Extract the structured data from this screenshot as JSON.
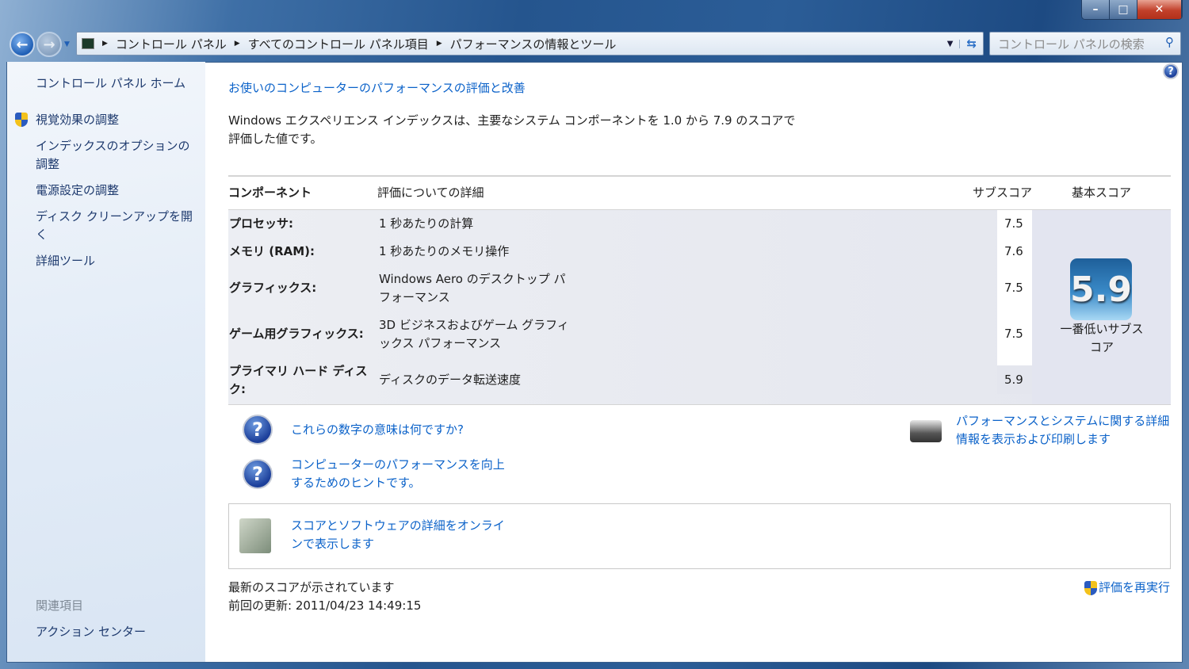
{
  "window": {
    "minimize": "–",
    "maximize": "□",
    "close": "✕"
  },
  "address_bar": {
    "crumbs": [
      "コントロール パネル",
      "すべてのコントロール パネル項目",
      "パフォーマンスの情報とツール"
    ]
  },
  "search": {
    "placeholder": "コントロール パネルの検索"
  },
  "sidebar": {
    "home": "コントロール パネル ホーム",
    "items": [
      "視覚効果の調整",
      "インデックスのオプションの調整",
      "電源設定の調整",
      "ディスク クリーンアップを開く",
      "詳細ツール"
    ],
    "related_heading": "関連項目",
    "related": [
      "アクション センター"
    ]
  },
  "main": {
    "title": "お使いのコンピューターのパフォーマンスの評価と改善",
    "description": "Windows エクスペリエンス インデックスは、主要なシステム コンポーネントを 1.0 から 7.9 のスコアで評価した値です。",
    "table": {
      "headers": [
        "コンポーネント",
        "評価についての詳細",
        "サブスコア",
        "基本スコア"
      ],
      "rows": [
        {
          "component": "プロセッサ:",
          "detail": "1 秒あたりの計算",
          "subscore": "7.5"
        },
        {
          "component": "メモリ (RAM):",
          "detail": "1 秒あたりのメモリ操作",
          "subscore": "7.6"
        },
        {
          "component": "グラフィックス:",
          "detail": "Windows Aero のデスクトップ パフォーマンス",
          "subscore": "7.5"
        },
        {
          "component": "ゲーム用グラフィックス:",
          "detail": "3D ビジネスおよびゲーム グラフィックス パフォーマンス",
          "subscore": "7.5"
        },
        {
          "component": "プライマリ ハード ディスク:",
          "detail": "ディスクのデータ転送速度",
          "subscore": "5.9"
        }
      ],
      "base_score": "5.9",
      "base_score_caption": "一番低いサブスコア"
    },
    "links": {
      "what_numbers": "これらの数字の意味は何ですか?",
      "tips": "コンピューターのパフォーマンスを向上するためのヒントです。",
      "print": "パフォーマンスとシステムに関する詳細情報を表示および印刷します",
      "online": "スコアとソフトウェアの詳細をオンラインで表示します",
      "rerun": "評価を再実行"
    },
    "status": "最新のスコアが示されています",
    "last_update": "前回の更新: 2011/04/23 14:49:15"
  }
}
